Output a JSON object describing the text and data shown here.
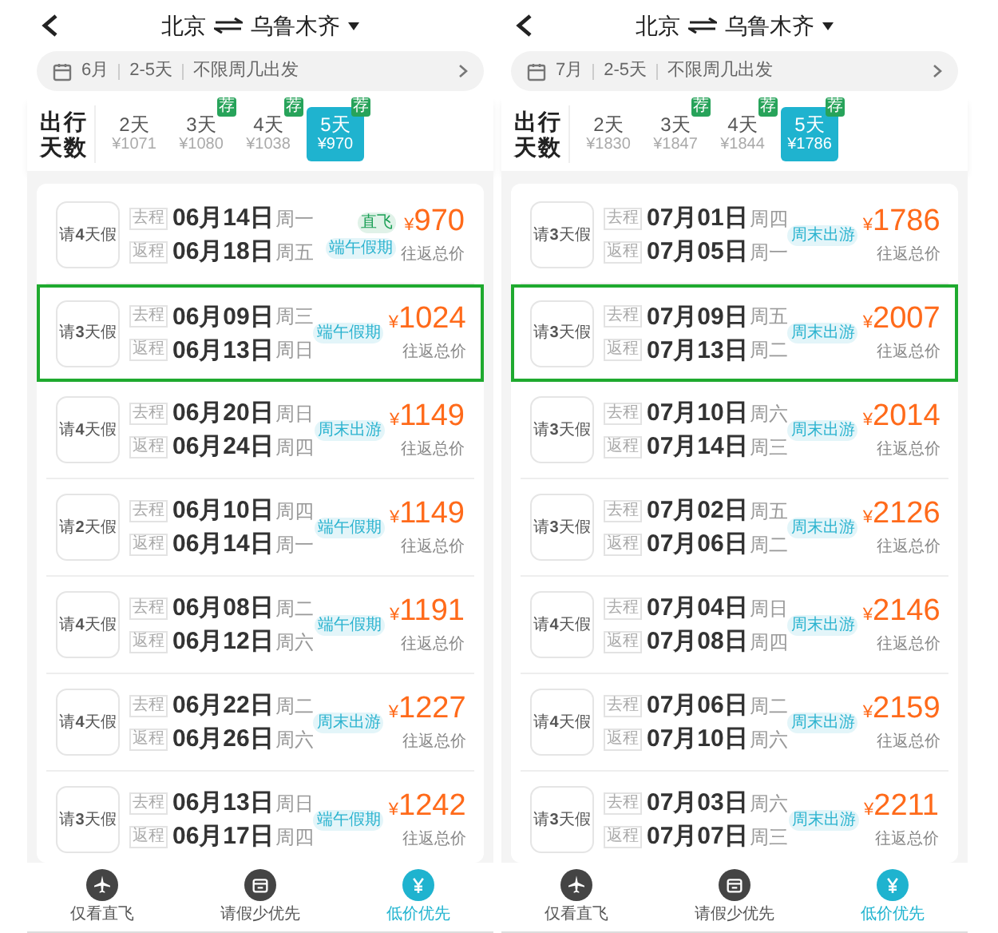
{
  "screens": [
    {
      "header": {
        "from": "北京",
        "to": "乌鲁木齐"
      },
      "filter": {
        "month": "6月",
        "duration": "2-5天",
        "weekday": "不限周几出发"
      },
      "trip_days_label": "出行天数",
      "day_options": [
        {
          "label": "2天",
          "price": "¥1071",
          "selected": false
        },
        {
          "label": "3天",
          "price": "¥1080",
          "badge": "荐",
          "selected": false
        },
        {
          "label": "4天",
          "price": "¥1038",
          "badge": "荐",
          "selected": false
        },
        {
          "label": "5天",
          "price": "¥970",
          "badge": "荐",
          "selected": true
        }
      ],
      "flights": [
        {
          "leave": "请**4**天假",
          "out_label": "去程",
          "out_date": "06月14日",
          "out_weekday": "周一",
          "ret_label": "返程",
          "ret_date": "06月18日",
          "ret_weekday": "周五",
          "tags": [
            {
              "text": "直飞",
              "color": "#1a9f55"
            },
            {
              "text": "端午假期",
              "color": "#2bb3cf"
            }
          ],
          "currency": "¥",
          "price": "970",
          "note": "往返总价",
          "highlighted": false
        },
        {
          "leave": "请**3**天假",
          "out_label": "去程",
          "out_date": "06月09日",
          "out_weekday": "周三",
          "ret_label": "返程",
          "ret_date": "06月13日",
          "ret_weekday": "周日",
          "tags": [
            {
              "text": "端午假期",
              "color": "#2bb3cf"
            }
          ],
          "currency": "¥",
          "price": "1024",
          "note": "往返总价",
          "highlighted": true
        },
        {
          "leave": "请**4**天假",
          "out_label": "去程",
          "out_date": "06月20日",
          "out_weekday": "周日",
          "ret_label": "返程",
          "ret_date": "06月24日",
          "ret_weekday": "周四",
          "tags": [
            {
              "text": "周末出游",
              "color": "#2bb3cf"
            }
          ],
          "currency": "¥",
          "price": "1149",
          "note": "往返总价",
          "highlighted": false
        },
        {
          "leave": "请**2**天假",
          "out_label": "去程",
          "out_date": "06月10日",
          "out_weekday": "周四",
          "ret_label": "返程",
          "ret_date": "06月14日",
          "ret_weekday": "周一",
          "tags": [
            {
              "text": "端午假期",
              "color": "#2bb3cf"
            }
          ],
          "currency": "¥",
          "price": "1149",
          "note": "往返总价",
          "highlighted": false
        },
        {
          "leave": "请**4**天假",
          "out_label": "去程",
          "out_date": "06月08日",
          "out_weekday": "周二",
          "ret_label": "返程",
          "ret_date": "06月12日",
          "ret_weekday": "周六",
          "tags": [
            {
              "text": "端午假期",
              "color": "#2bb3cf"
            }
          ],
          "currency": "¥",
          "price": "1191",
          "note": "往返总价",
          "highlighted": false
        },
        {
          "leave": "请**4**天假",
          "out_label": "去程",
          "out_date": "06月22日",
          "out_weekday": "周二",
          "ret_label": "返程",
          "ret_date": "06月26日",
          "ret_weekday": "周六",
          "tags": [
            {
              "text": "周末出游",
              "color": "#2bb3cf"
            }
          ],
          "currency": "¥",
          "price": "1227",
          "note": "往返总价",
          "highlighted": false
        },
        {
          "leave": "请**3**天假",
          "out_label": "去程",
          "out_date": "06月13日",
          "out_weekday": "周日",
          "ret_label": "返程",
          "ret_date": "06月17日",
          "ret_weekday": "周四",
          "tags": [
            {
              "text": "端午假期",
              "color": "#2bb3cf"
            }
          ],
          "currency": "¥",
          "price": "1242",
          "note": "往返总价",
          "highlighted": false
        }
      ],
      "nav": [
        {
          "kind": "plane",
          "label": "仅看直飞",
          "selected": false
        },
        {
          "kind": "calendar",
          "label": "请假少优先",
          "selected": false
        },
        {
          "kind": "yen",
          "label": "低价优先",
          "selected": true
        }
      ]
    },
    {
      "header": {
        "from": "北京",
        "to": "乌鲁木齐"
      },
      "filter": {
        "month": "7月",
        "duration": "2-5天",
        "weekday": "不限周几出发"
      },
      "trip_days_label": "出行天数",
      "day_options": [
        {
          "label": "2天",
          "price": "¥1830",
          "selected": false
        },
        {
          "label": "3天",
          "price": "¥1847",
          "badge": "荐",
          "selected": false
        },
        {
          "label": "4天",
          "price": "¥1844",
          "badge": "荐",
          "selected": false
        },
        {
          "label": "5天",
          "price": "¥1786",
          "badge": "荐",
          "selected": true
        }
      ],
      "flights": [
        {
          "leave": "请**3**天假",
          "out_label": "去程",
          "out_date": "07月01日",
          "out_weekday": "周四",
          "ret_label": "返程",
          "ret_date": "07月05日",
          "ret_weekday": "周一",
          "tags": [
            {
              "text": "周末出游",
              "color": "#2bb3cf"
            }
          ],
          "currency": "¥",
          "price": "1786",
          "note": "往返总价",
          "highlighted": false
        },
        {
          "leave": "请**3**天假",
          "out_label": "去程",
          "out_date": "07月09日",
          "out_weekday": "周五",
          "ret_label": "返程",
          "ret_date": "07月13日",
          "ret_weekday": "周二",
          "tags": [
            {
              "text": "周末出游",
              "color": "#2bb3cf"
            }
          ],
          "currency": "¥",
          "price": "2007",
          "note": "往返总价",
          "highlighted": true
        },
        {
          "leave": "请**3**天假",
          "out_label": "去程",
          "out_date": "07月10日",
          "out_weekday": "周六",
          "ret_label": "返程",
          "ret_date": "07月14日",
          "ret_weekday": "周三",
          "tags": [
            {
              "text": "周末出游",
              "color": "#2bb3cf"
            }
          ],
          "currency": "¥",
          "price": "2014",
          "note": "往返总价",
          "highlighted": false
        },
        {
          "leave": "请**3**天假",
          "out_label": "去程",
          "out_date": "07月02日",
          "out_weekday": "周五",
          "ret_label": "返程",
          "ret_date": "07月06日",
          "ret_weekday": "周二",
          "tags": [
            {
              "text": "周末出游",
              "color": "#2bb3cf"
            }
          ],
          "currency": "¥",
          "price": "2126",
          "note": "往返总价",
          "highlighted": false
        },
        {
          "leave": "请**4**天假",
          "out_label": "去程",
          "out_date": "07月04日",
          "out_weekday": "周日",
          "ret_label": "返程",
          "ret_date": "07月08日",
          "ret_weekday": "周四",
          "tags": [
            {
              "text": "周末出游",
              "color": "#2bb3cf"
            }
          ],
          "currency": "¥",
          "price": "2146",
          "note": "往返总价",
          "highlighted": false
        },
        {
          "leave": "请**4**天假",
          "out_label": "去程",
          "out_date": "07月06日",
          "out_weekday": "周二",
          "ret_label": "返程",
          "ret_date": "07月10日",
          "ret_weekday": "周六",
          "tags": [
            {
              "text": "周末出游",
              "color": "#2bb3cf"
            }
          ],
          "currency": "¥",
          "price": "2159",
          "note": "往返总价",
          "highlighted": false
        },
        {
          "leave": "请**3**天假",
          "out_label": "去程",
          "out_date": "07月03日",
          "out_weekday": "周六",
          "ret_label": "返程",
          "ret_date": "07月07日",
          "ret_weekday": "周三",
          "tags": [
            {
              "text": "周末出游",
              "color": "#2bb3cf"
            }
          ],
          "currency": "¥",
          "price": "2211",
          "note": "往返总价",
          "highlighted": false
        }
      ],
      "nav": [
        {
          "kind": "plane",
          "label": "仅看直飞",
          "selected": false
        },
        {
          "kind": "calendar",
          "label": "请假少优先",
          "selected": false
        },
        {
          "kind": "yen",
          "label": "低价优先",
          "selected": true
        }
      ]
    }
  ]
}
